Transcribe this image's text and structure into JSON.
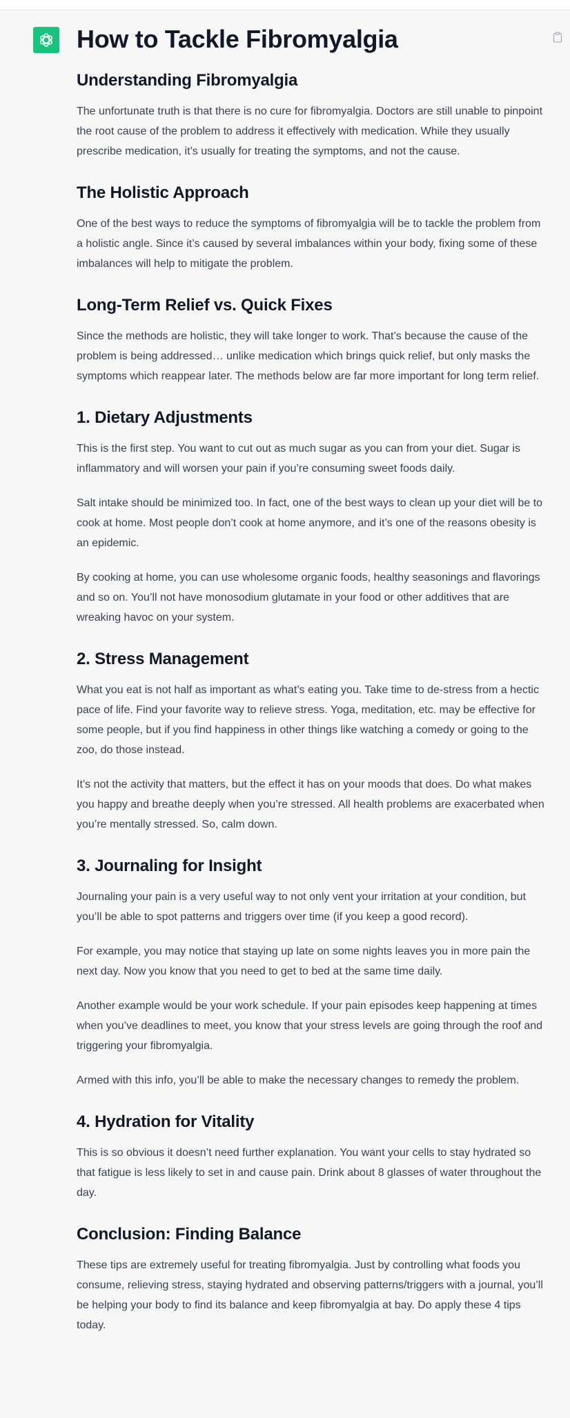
{
  "icons": {
    "avatar": "openai-logo-icon",
    "copy": "clipboard-icon"
  },
  "colors": {
    "avatar_bg": "#19c37d",
    "heading": "#111827",
    "body_text": "#374151",
    "page_bg": "#f7f7f8"
  },
  "article": {
    "title": "How to Tackle Fibromyalgia",
    "sections": [
      {
        "heading": "Understanding Fibromyalgia",
        "paragraphs": [
          "The unfortunate truth is that there is no cure for fibromyalgia. Doctors are still unable to pinpoint the root cause of the problem to address it effectively with medication. While they usually prescribe medication, it’s usually for treating the symptoms, and not the cause."
        ]
      },
      {
        "heading": "The Holistic Approach",
        "paragraphs": [
          "One of the best ways to reduce the symptoms of fibromyalgia will be to tackle the problem from a holistic angle. Since it’s caused by several imbalances within your body, fixing some of these imbalances will help to mitigate the problem."
        ]
      },
      {
        "heading": "Long-Term Relief vs. Quick Fixes",
        "paragraphs": [
          "Since the methods are holistic, they will take longer to work. That’s because the cause of the problem is being addressed… unlike medication which brings quick relief, but only masks the symptoms which reappear later. The methods below are far more important for long term relief."
        ]
      },
      {
        "heading": "1. Dietary Adjustments",
        "paragraphs": [
          "This is the first step. You want to cut out as much sugar as you can from your diet. Sugar is inflammatory and will worsen your pain if you’re consuming sweet foods daily.",
          "Salt intake should be minimized too. In fact, one of the best ways to clean up your diet will be to cook at home. Most people don’t cook at home anymore, and it’s one of the reasons obesity is an epidemic.",
          "By cooking at home, you can use wholesome organic foods, healthy seasonings and flavorings and so on. You’ll not have monosodium glutamate in your food or other additives that are wreaking havoc on your system."
        ]
      },
      {
        "heading": "2. Stress Management",
        "paragraphs": [
          "What you eat is not half as important as what’s eating you. Take time to de-stress from a hectic pace of life. Find your favorite way to relieve stress. Yoga, meditation, etc. may be effective for some people, but if you find happiness in other things like watching a comedy or going to the zoo, do those instead.",
          "It’s not the activity that matters, but the effect it has on your moods that does. Do what makes you happy and breathe deeply when you’re stressed. All health problems are exacerbated when you’re mentally stressed. So, calm down."
        ]
      },
      {
        "heading": "3. Journaling for Insight",
        "paragraphs": [
          "Journaling your pain is a very useful way to not only vent your irritation at your condition, but you’ll be able to spot patterns and triggers over time (if you keep a good record).",
          "For example, you may notice that staying up late on some nights leaves you in more pain the next day. Now you know that you need to get to bed at the same time daily.",
          "Another example would be your work schedule. If your pain episodes keep happening at times when you’ve deadlines to meet, you know that your stress levels are going through the roof and triggering your fibromyalgia.",
          "Armed with this info, you’ll be able to make the necessary changes to remedy the problem."
        ]
      },
      {
        "heading": "4. Hydration for Vitality",
        "paragraphs": [
          "This is so obvious it doesn’t need further explanation. You want your cells to stay hydrated so that fatigue is less likely to set in and cause pain. Drink about 8 glasses of water throughout the day."
        ]
      },
      {
        "heading": "Conclusion: Finding Balance",
        "paragraphs": [
          "These tips are extremely useful for treating fibromyalgia. Just by controlling what foods you consume, relieving stress, staying hydrated and observing patterns/triggers with a journal, you’ll be helping your body to find its balance and keep fibromyalgia at bay. Do apply these 4 tips today."
        ]
      }
    ]
  }
}
